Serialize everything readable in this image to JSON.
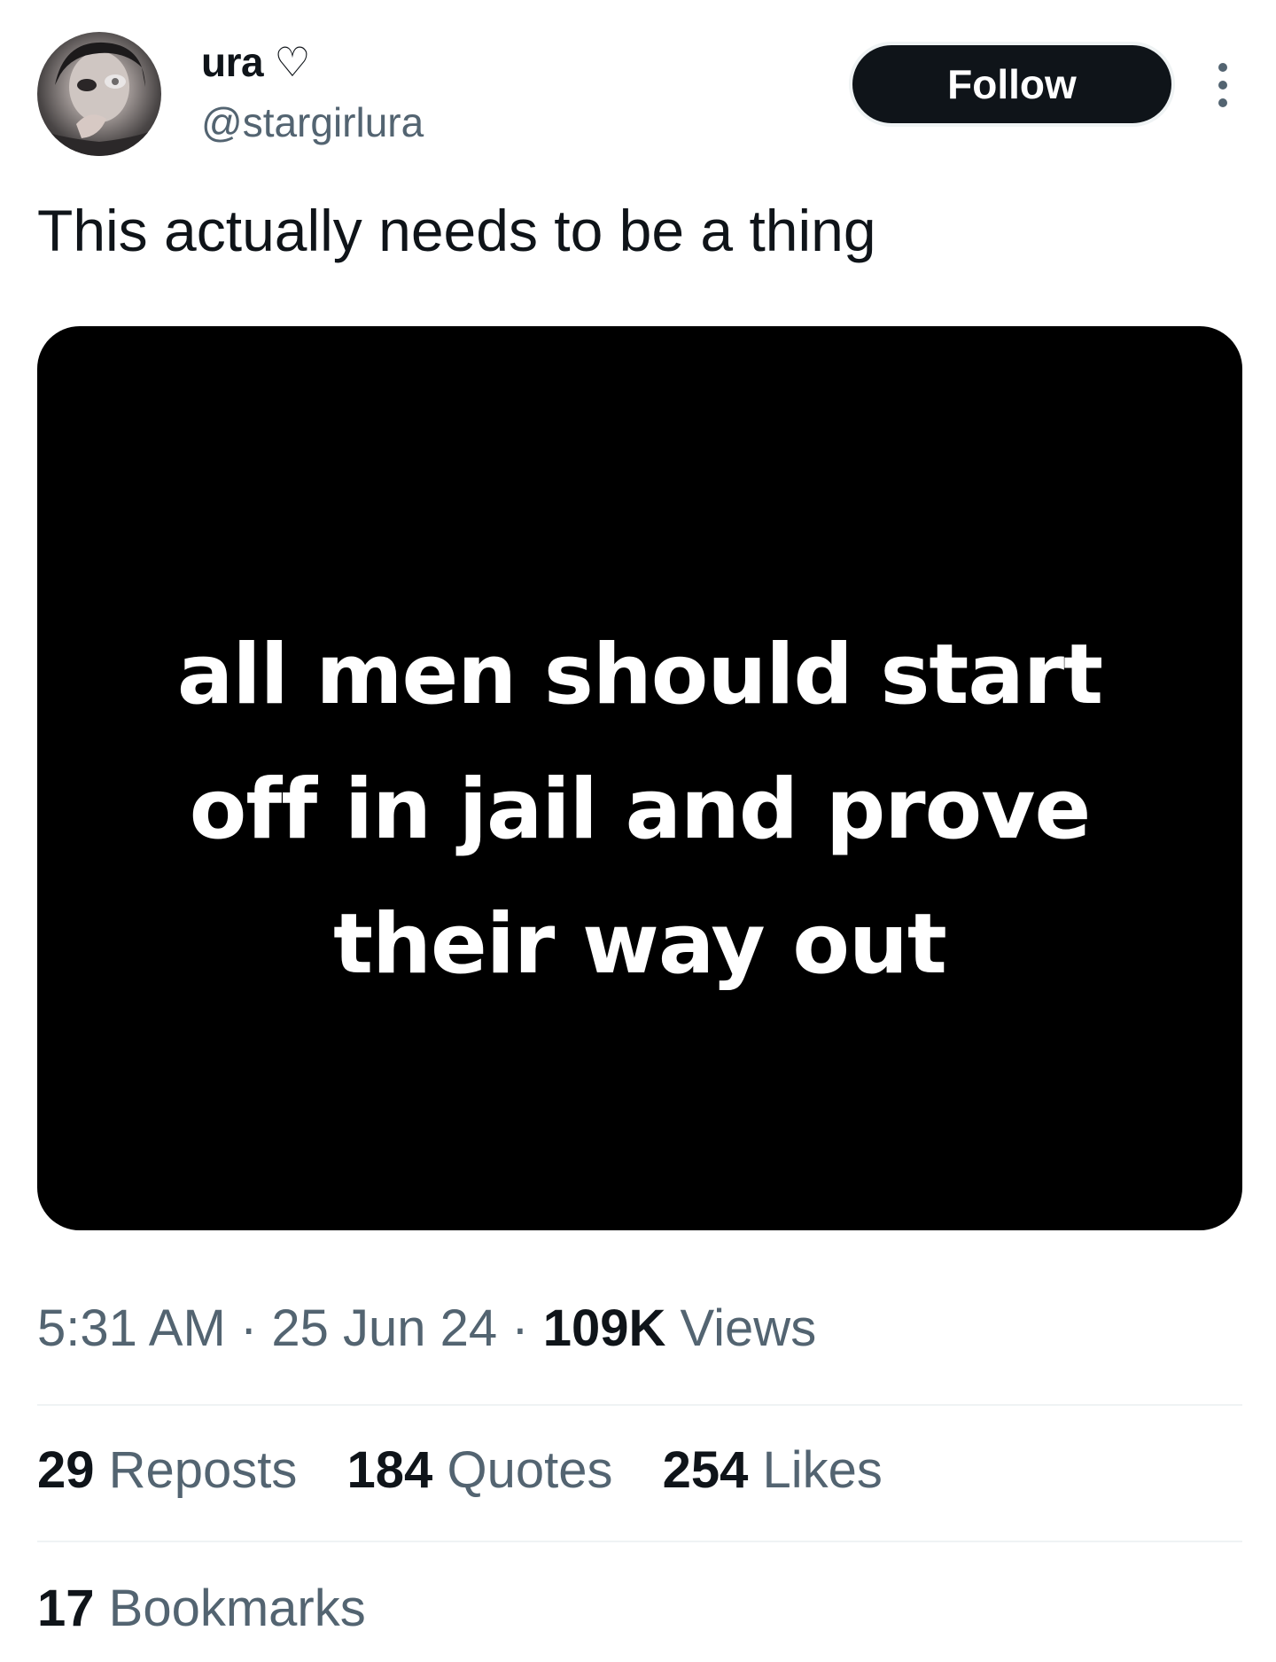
{
  "author": {
    "display_name": "ura ♡",
    "handle": "@stargirlura",
    "avatar_icon": "user-avatar"
  },
  "header": {
    "follow_label": "Follow",
    "more_icon": "more-vertical-icon"
  },
  "tweet": {
    "text": "This actually needs to be a thing",
    "media_text_lines": [
      "all men should start",
      "off in jail and prove",
      "their way out"
    ]
  },
  "meta": {
    "time": "5:31 AM",
    "separator": "·",
    "date": "25 Jun 24",
    "views_count": "109K",
    "views_label": "Views"
  },
  "stats": {
    "reposts_count": "29",
    "reposts_label": "Reposts",
    "quotes_count": "184",
    "quotes_label": "Quotes",
    "likes_count": "254",
    "likes_label": "Likes",
    "bookmarks_count": "17",
    "bookmarks_label": "Bookmarks"
  },
  "colors": {
    "text_primary": "#0f1419",
    "text_secondary": "#536471",
    "divider": "#eff3f4",
    "media_background": "#000000"
  }
}
